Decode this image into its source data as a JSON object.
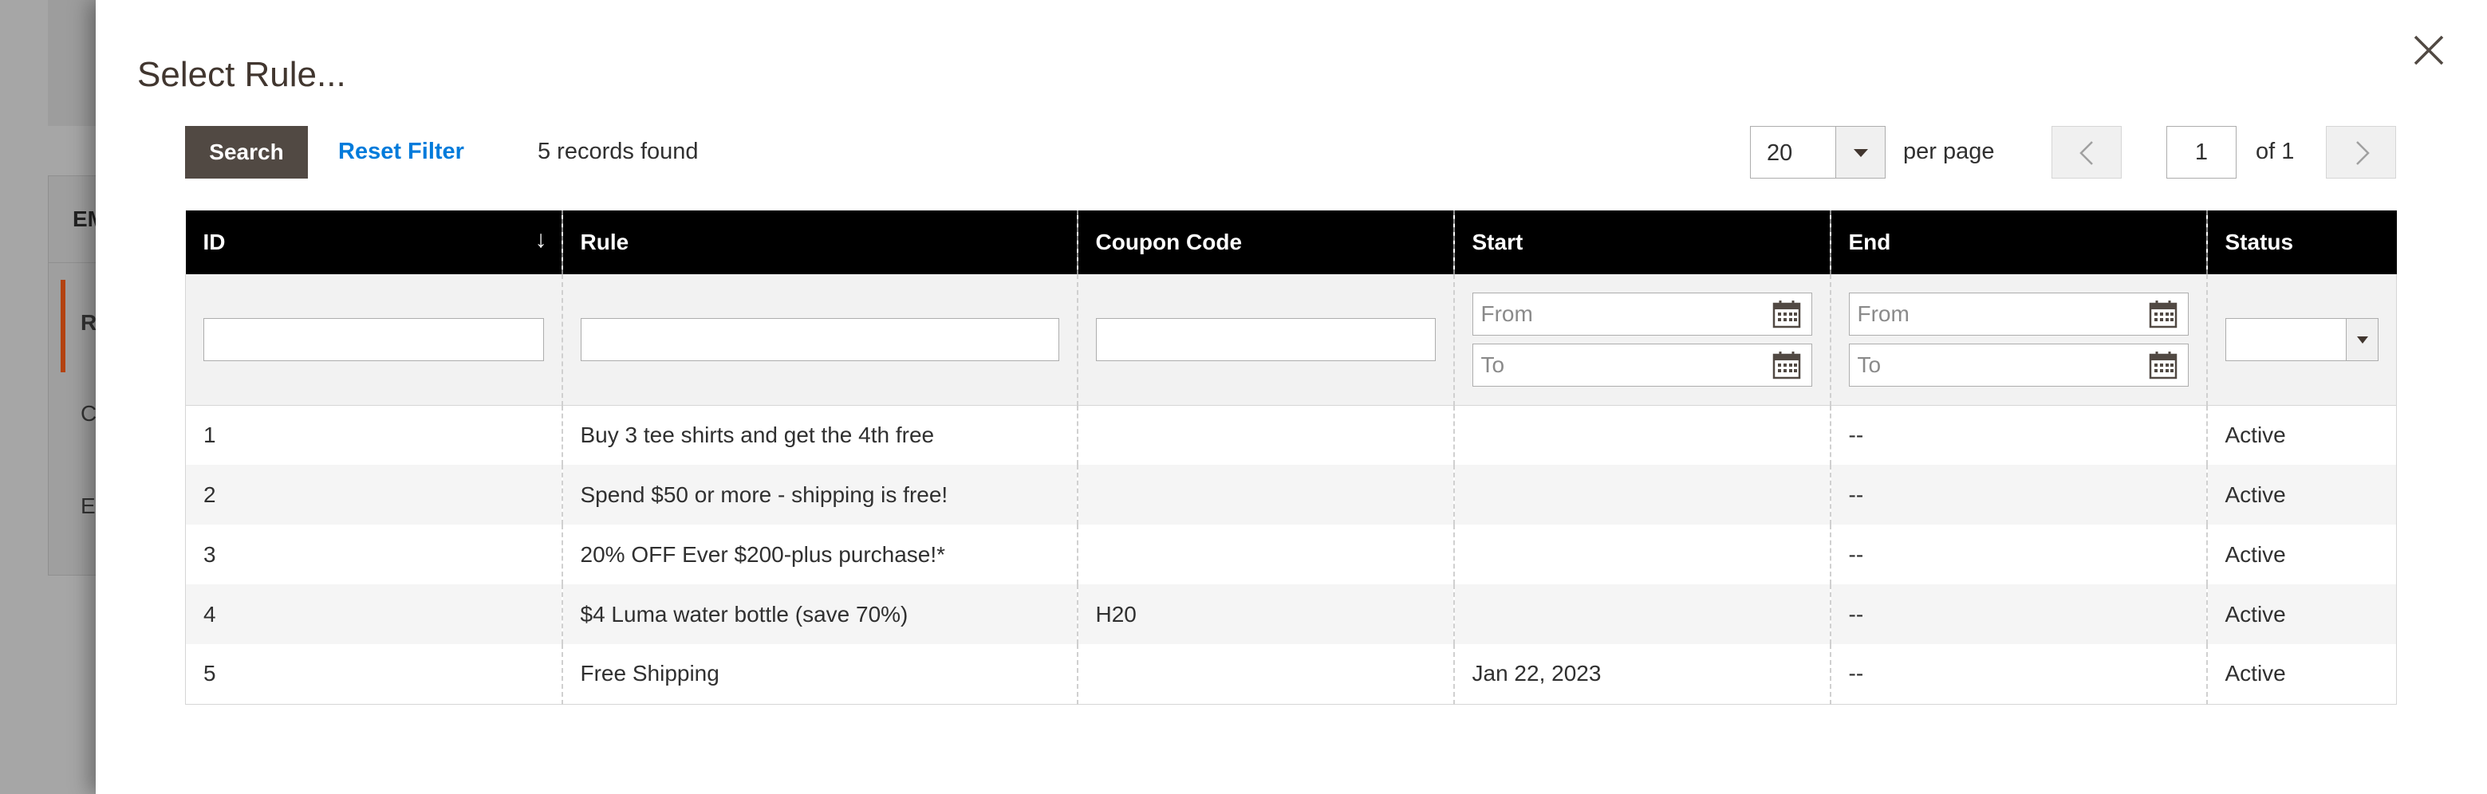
{
  "background": {
    "panel_heading": "EM",
    "panel_items": [
      "R",
      "C",
      "E"
    ]
  },
  "modal": {
    "title": "Select Rule..."
  },
  "toolbar": {
    "search_label": "Search",
    "reset_label": "Reset Filter",
    "records_found": "5 records found",
    "per_page_value": "20",
    "per_page_label": "per page",
    "current_page": "1",
    "page_of": "of 1"
  },
  "grid": {
    "columns": [
      "ID",
      "Rule",
      "Coupon Code",
      "Start",
      "End",
      "Status"
    ],
    "sort_indicator": "↓",
    "filters": {
      "start_from_placeholder": "From",
      "start_to_placeholder": "To",
      "end_from_placeholder": "From",
      "end_to_placeholder": "To"
    },
    "rows": [
      {
        "id": "1",
        "rule": "Buy 3 tee shirts and get the 4th free",
        "coupon": "",
        "start": "",
        "end": "--",
        "status": "Active"
      },
      {
        "id": "2",
        "rule": "Spend $50 or more - shipping is free!",
        "coupon": "",
        "start": "",
        "end": "--",
        "status": "Active"
      },
      {
        "id": "3",
        "rule": "20% OFF Ever $200-plus purchase!*",
        "coupon": "",
        "start": "",
        "end": "--",
        "status": "Active"
      },
      {
        "id": "4",
        "rule": "$4 Luma water bottle (save 70%)",
        "coupon": "H20",
        "start": "",
        "end": "--",
        "status": "Active"
      },
      {
        "id": "5",
        "rule": "Free Shipping",
        "coupon": "",
        "start": "Jan 22, 2023",
        "end": "--",
        "status": "Active"
      }
    ]
  },
  "colors": {
    "primary_button": "#514943",
    "link": "#007bdb",
    "header_bg": "#000000",
    "active_accent": "#b34210"
  }
}
